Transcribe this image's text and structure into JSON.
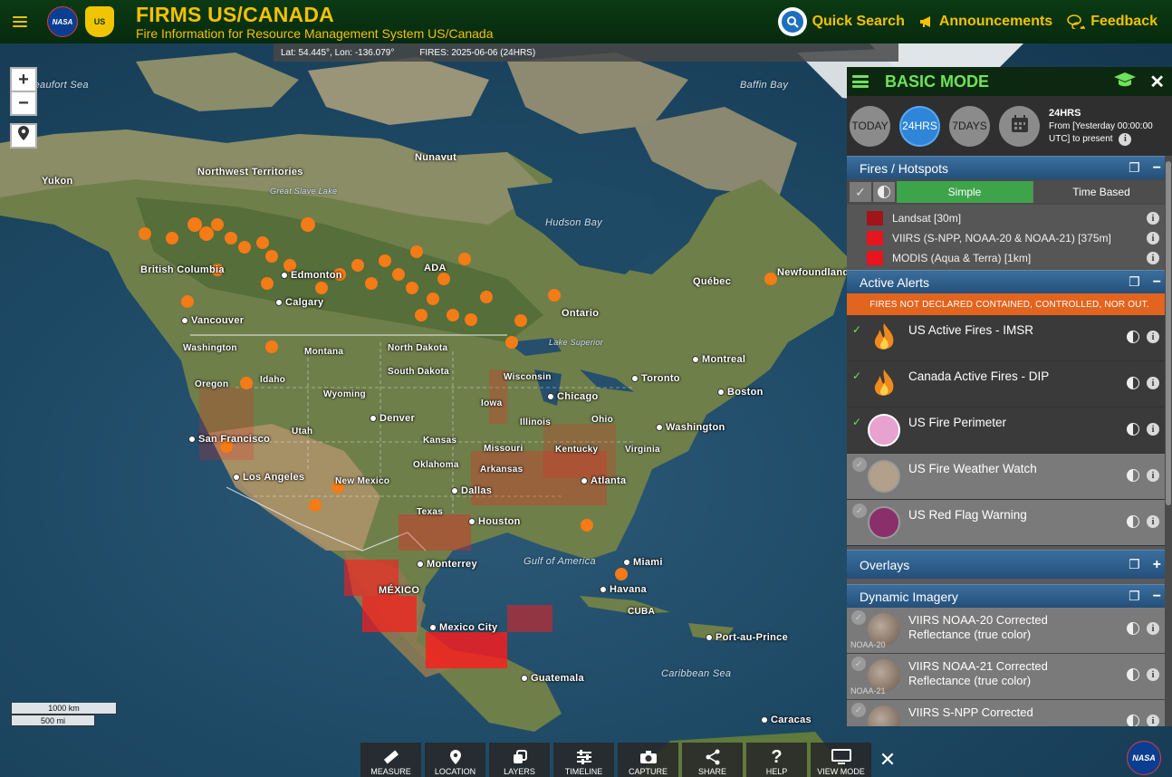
{
  "header": {
    "title": "FIRMS US/CANADA",
    "subtitle": "Fire Information for Resource Management System US/Canada",
    "nasa_logo": "NASA",
    "usfs_logo": "US",
    "quick_search": "Quick Search",
    "announcements": "Announcements",
    "feedback": "Feedback"
  },
  "coord_bar": {
    "latlon": "Lat: 54.445°, Lon: -136.079°",
    "fires": "FIRES: 2025-06-06 (24HRS)"
  },
  "map_controls": {
    "zoom_in": "+",
    "zoom_out": "−"
  },
  "scale": {
    "km": "1000 km",
    "mi": "500 mi"
  },
  "map_labels": {
    "water": [
      "Beaufort Sea",
      "Baffin Bay",
      "Hudson Bay",
      "Gulf of America",
      "Caribbean Sea",
      "Great Slave Lake",
      "Lake Superior"
    ],
    "regions": [
      "Yukon",
      "Northwest Territories",
      "Nunavut",
      "British Columbia",
      "Ontario",
      "Québec",
      "Newfoundland and Labrador",
      "ADA",
      "North Dakota",
      "South Dakota",
      "Wyoming",
      "Montana",
      "Washington",
      "Oregon",
      "Idaho",
      "Utah",
      "Iowa",
      "Illinois",
      "Ohio",
      "Kansas",
      "Missouri",
      "Kentucky",
      "Virginia",
      "Oklahoma",
      "Arkansas",
      "Texas",
      "New Mexico",
      "MÉXICO",
      "CUBA",
      "Wisconsin"
    ],
    "cities": [
      "Edmonton",
      "Calgary",
      "Vancouver",
      "Toronto",
      "Montreal",
      "Boston",
      "Chicago",
      "Denver",
      "Washington",
      "San Francisco",
      "Los Angeles",
      "Dallas",
      "Atlanta",
      "Houston",
      "Monterrey",
      "Miami",
      "Havana",
      "Mexico City",
      "Port-au-Prince",
      "Guatemala",
      "Caracas"
    ]
  },
  "toolbar": {
    "items": [
      "MEASURE",
      "LOCATION",
      "LAYERS",
      "TIMELINE",
      "CAPTURE",
      "SHARE",
      "HELP",
      "VIEW MODE"
    ],
    "close": "✕",
    "nasa": "NASA"
  },
  "panel": {
    "title": "BASIC MODE",
    "time": {
      "buttons": [
        "TODAY",
        "24HRS",
        "7DAYS"
      ],
      "active": "24HRS",
      "info_title": "24HRS",
      "info_line1": "From [Yesterday 00:00:00",
      "info_line2": "UTC] to present"
    },
    "fires": {
      "title": "Fires / Hotspots",
      "mode_simple": "Simple",
      "mode_time": "Time Based",
      "sensors": [
        {
          "label": "Landsat [30m]",
          "color": "#a3141a"
        },
        {
          "label": "VIIRS (S-NPP, NOAA-20 & NOAA-21) [375m]",
          "color": "#e8141e"
        },
        {
          "label": "MODIS (Aqua & Terra) [1km]",
          "color": "#e8141e"
        }
      ]
    },
    "alerts": {
      "title": "Active Alerts",
      "banner": "FIRES NOT DECLARED CONTAINED, CONTROLLED, NOR OUT.",
      "items": [
        {
          "label": "US Active Fires - IMSR",
          "thumb": "flame-icon",
          "on": true
        },
        {
          "label": "Canada Active Fires - DIP",
          "thumb": "flame-icon",
          "on": true
        },
        {
          "label": "US Fire Perimeter",
          "thumb": "#e8a2cf",
          "on": true
        },
        {
          "label": "US Fire Weather Watch",
          "thumb": "#b3a08a",
          "on": false
        },
        {
          "label": "US Red Flag Warning",
          "thumb": "#8a2f6a",
          "on": false
        }
      ]
    },
    "overlays": {
      "title": "Overlays"
    },
    "dynamic": {
      "title": "Dynamic Imagery",
      "items": [
        {
          "line1": "VIIRS NOAA-20 Corrected",
          "line2": "Reflectance (true color)",
          "tag": "NOAA-20"
        },
        {
          "line1": "VIIRS NOAA-21 Corrected",
          "line2": "Reflectance (true color)",
          "tag": "NOAA-21"
        },
        {
          "line1": "VIIRS S-NPP Corrected",
          "line2": "",
          "tag": ""
        }
      ]
    }
  }
}
